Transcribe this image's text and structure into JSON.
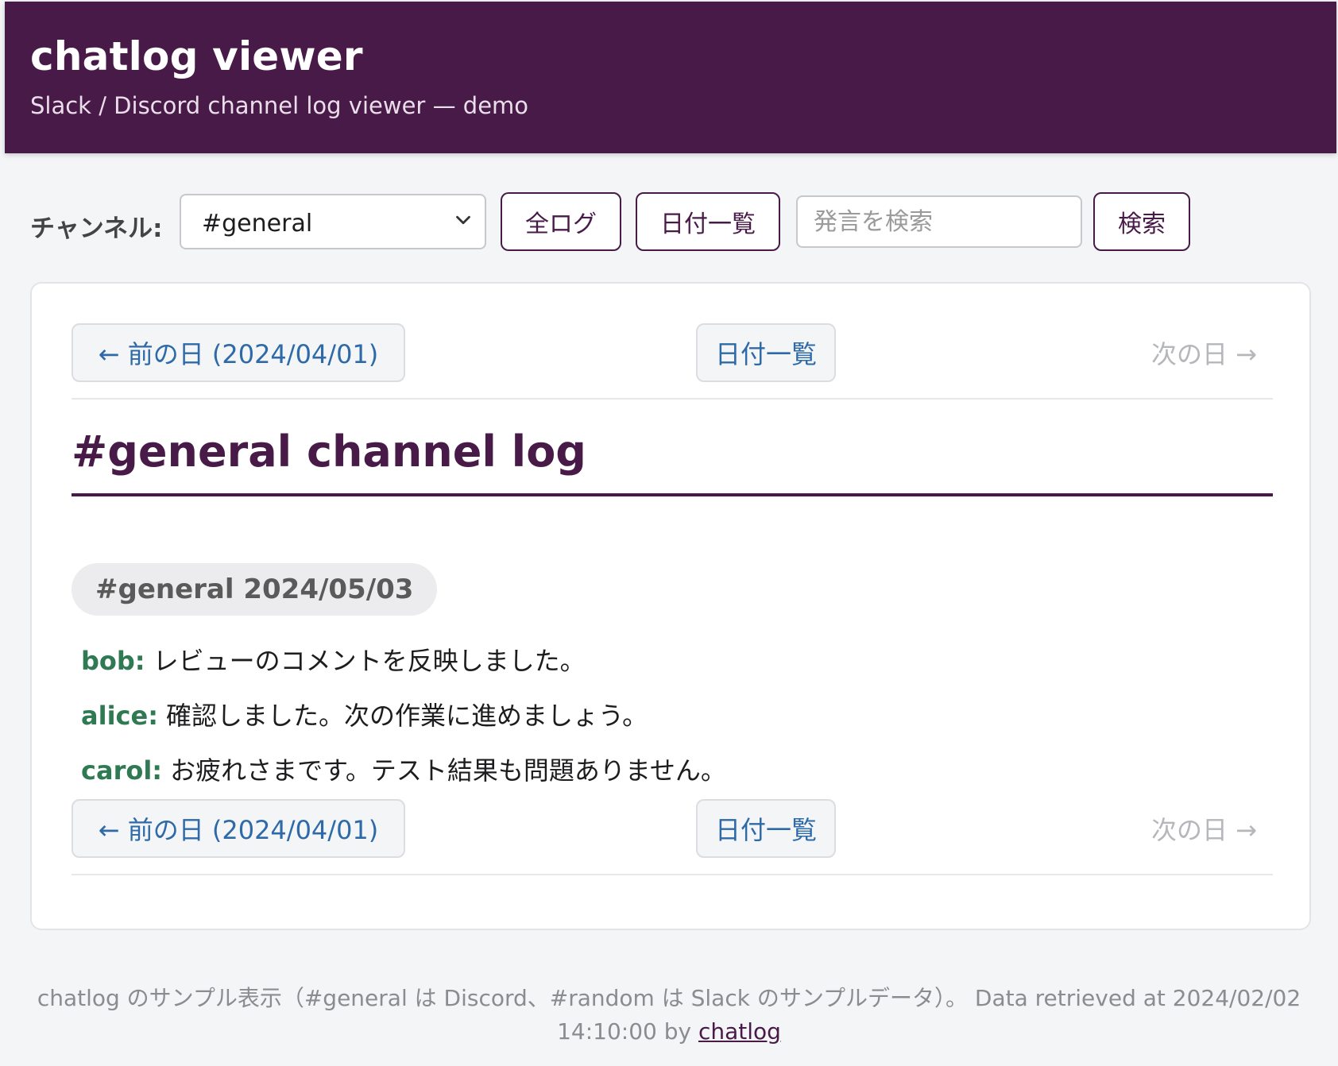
{
  "header": {
    "title": "chatlog viewer",
    "subtitle": "Slack / Discord channel log viewer — demo"
  },
  "toolbar": {
    "channel_label": "チャンネル:",
    "channel_selected": "#general",
    "all_logs_label": "全ログ",
    "date_list_label": "日付一覧",
    "search_placeholder": "発言を検索",
    "search_value": "",
    "search_label": "検索"
  },
  "nav": {
    "prev_label": "← 前の日 (2024/04/01)",
    "index_label": "日付一覧",
    "next_label": "次の日 →"
  },
  "log": {
    "title": "#general channel log",
    "date_heading": "#general 2024/05/03",
    "messages": [
      {
        "user": "bob:",
        "text": "レビューのコメントを反映しました。"
      },
      {
        "user": "alice:",
        "text": "確認しました。次の作業に進めましょう。"
      },
      {
        "user": "carol:",
        "text": "お疲れさまです。テスト結果も問題ありません。"
      }
    ]
  },
  "footer": {
    "line1": "chatlog のサンプル表示（#general は Discord、#random は Slack のサンプルデータ）。 Data retrieved at 2024/02/02",
    "line2_prefix": "14:10:00 by ",
    "link_label": "chatlog"
  },
  "colors": {
    "brand": "#481a48",
    "link": "#2e6aa8",
    "username": "#2f7a52",
    "background": "#f4f5f7"
  }
}
